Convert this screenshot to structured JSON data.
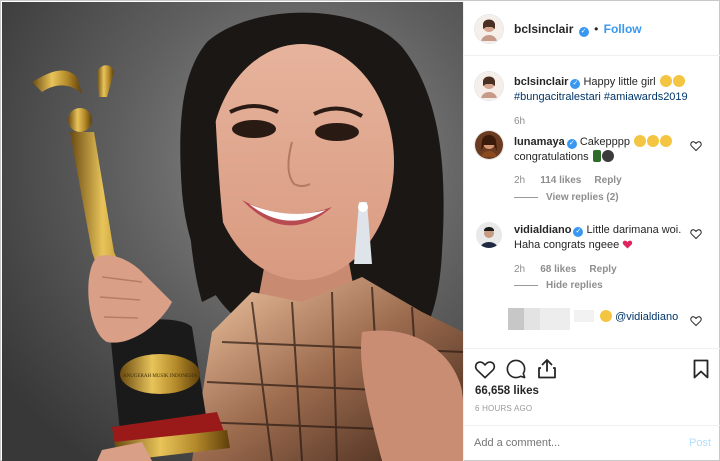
{
  "post_author": {
    "username": "bclsinclair",
    "follow_label": "Follow",
    "separator": "•"
  },
  "caption": {
    "username": "bclsinclair",
    "text": "Happy little girl",
    "hashtags": "#bungacitralestari #amiawards2019",
    "age": "6h"
  },
  "comments": [
    {
      "username": "lunamaya",
      "text": "Cakepppp",
      "text2": "congratulations",
      "age": "2h",
      "likes": "114 likes",
      "reply_label": "Reply",
      "replies_toggle": "View replies (2)"
    },
    {
      "username": "vidialdiano",
      "text": "Little darimana woi.",
      "text2": "Haha congrats ngeee",
      "age": "2h",
      "likes": "68 likes",
      "reply_label": "Reply",
      "replies_toggle": "Hide replies"
    },
    {
      "username": "",
      "mention": "@vidialdiano"
    }
  ],
  "stats": {
    "likes": "66,658 likes",
    "timestamp": "6 HOURS AGO"
  },
  "add_comment": {
    "placeholder": "Add a comment...",
    "post_label": "Post"
  },
  "trophy_plaque": "ANUGERAH MUSIK INDONESIA",
  "colors": {
    "link_blue": "#3897f0",
    "hashtag_blue": "#003569",
    "meta_gray": "#8e8e8e",
    "heart_red": "#ed4956"
  },
  "icons": [
    "heart-icon",
    "comment-icon",
    "share-icon",
    "bookmark-icon",
    "verified-icon",
    "heart-outline-icon"
  ]
}
